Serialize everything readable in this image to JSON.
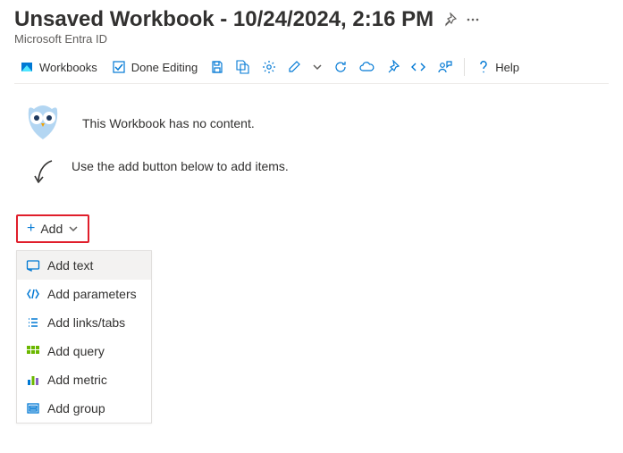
{
  "header": {
    "title": "Unsaved Workbook - 10/24/2024, 2:16 PM",
    "subtitle": "Microsoft Entra ID"
  },
  "toolbar": {
    "workbooks": "Workbooks",
    "done_editing": "Done Editing",
    "help": "Help"
  },
  "empty_state": {
    "message": "This Workbook has no content.",
    "hint": "Use the add button below to add items."
  },
  "add_button": {
    "label": "Add"
  },
  "add_menu": {
    "items": [
      {
        "label": "Add text"
      },
      {
        "label": "Add parameters"
      },
      {
        "label": "Add links/tabs"
      },
      {
        "label": "Add query"
      },
      {
        "label": "Add metric"
      },
      {
        "label": "Add group"
      }
    ]
  }
}
